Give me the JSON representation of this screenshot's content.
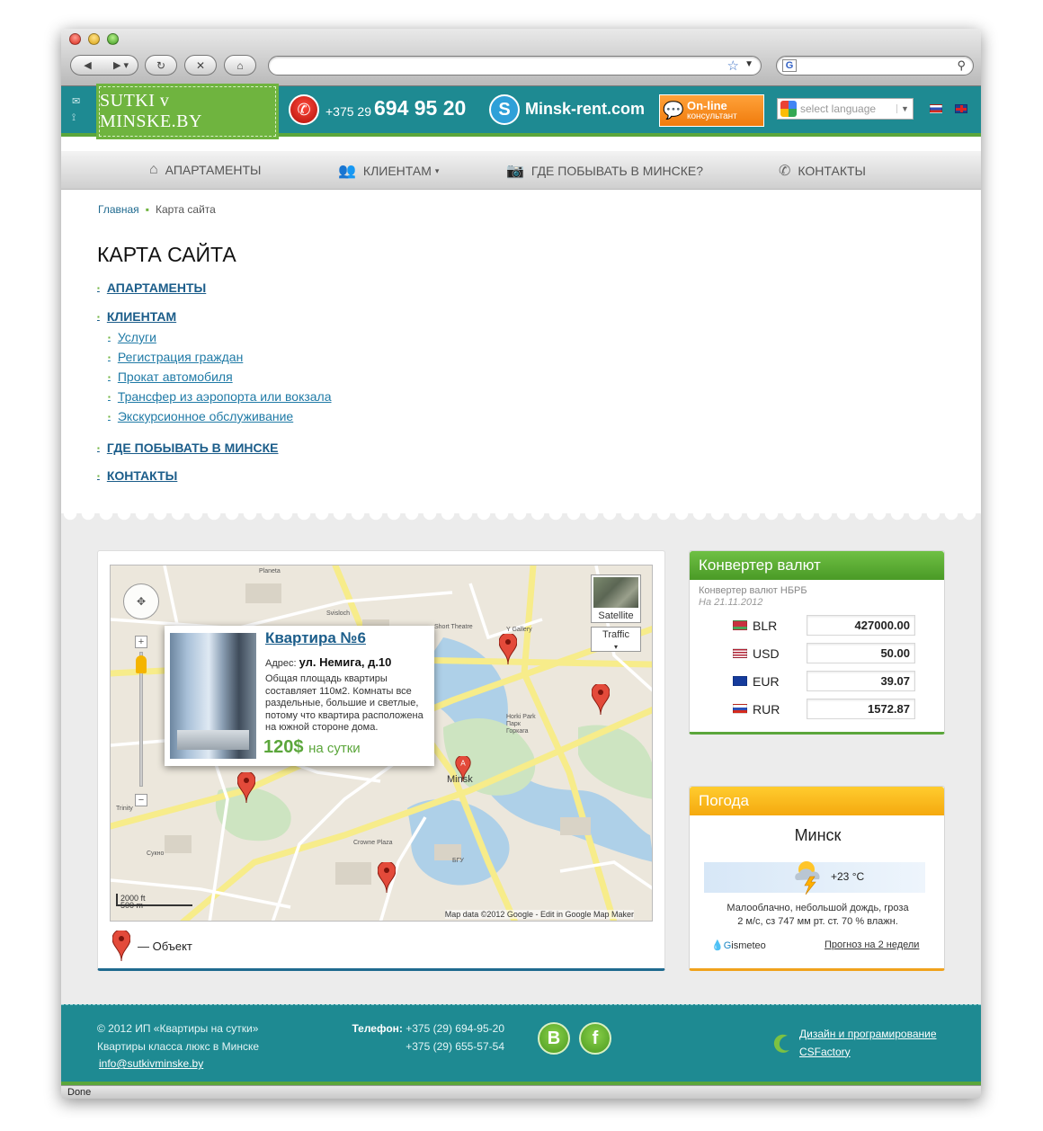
{
  "header": {
    "logo": "SUTKI v MINSKE.BY",
    "phone_code": "+375 29",
    "phone_number": "694 95 20",
    "skype_site": "Minsk-rent.com",
    "online_line1": "On-line",
    "online_line2": "консультант",
    "language_placeholder": "select language"
  },
  "nav": [
    {
      "label": "АПАРТАМЕНТЫ",
      "icon": "home-icon"
    },
    {
      "label": "КЛИЕНТАМ",
      "icon": "users-icon"
    },
    {
      "label": "ГДЕ ПОБЫВАТЬ В МИНСКЕ?",
      "icon": "camera-icon"
    },
    {
      "label": "КОНТАКТЫ",
      "icon": "phone-icon"
    }
  ],
  "breadcrumb": {
    "home": "Главная",
    "current": "Карта сайта"
  },
  "page_title": "КАРТА САЙТА",
  "sitemap": {
    "apartments": "АПАРТАМЕНТЫ",
    "clients": "КЛИЕНТАМ",
    "clients_sub": [
      "Услуги",
      "Регистрация граждан",
      "Прокат автомобиля",
      "Трансфер из аэропорта или вокзала",
      "Экскурсионное обслуживание"
    ],
    "places": "ГДЕ ПОБЫВАТЬ В МИНСКЕ",
    "contacts": "КОНТАКТЫ"
  },
  "map": {
    "satellite": "Satellite",
    "traffic": "Traffic",
    "city_label": "Minsk",
    "scale_top": "2000 ft",
    "scale_bottom": "500 m",
    "attribution": "Map data ©2012 Google - Edit in Google Map Maker",
    "info": {
      "title": "Квартира №6",
      "address_label": "Адрес:",
      "address": "ул. Немига, д.10",
      "description": "Общая площадь квартиры составляет 110м2. Комнаты все раздельные, большие и светлые, потому что квартира расположена на южной стороне дома.",
      "price": "120$",
      "price_unit": "на сутки"
    },
    "legend": "— Объект"
  },
  "converter": {
    "title": "Конвертер валют",
    "source": "Конвертер валют НБРБ",
    "date": "На 21.11.2012",
    "rates": [
      {
        "code": "BLR",
        "value": "427000.00"
      },
      {
        "code": "USD",
        "value": "50.00"
      },
      {
        "code": "EUR",
        "value": "39.07"
      },
      {
        "code": "RUR",
        "value": "1572.87"
      }
    ]
  },
  "weather": {
    "title": "Погода",
    "city": "Минск",
    "temp": "+23 °C",
    "desc_line1": "Малооблачно, небольшой дождь, гроза",
    "desc_line2": "2 м/с, сз   747 мм рт. ст.   70 % влажн.",
    "provider_prefix": "G",
    "provider": "ismeteo",
    "forecast_link": "Прогноз на 2 недели"
  },
  "footer": {
    "copy1": "© 2012 ИП «Квартиры на сутки»",
    "copy2": "Квартиры класса люкс в Минске",
    "email": "info@sutkivminske.by",
    "tel_label": "Телефон:",
    "tel1": "+375 (29) 694-95-20",
    "tel2": "+375 (29) 655-57-54",
    "design1": "Дизайн и програмирование",
    "design2": "CSFactory"
  },
  "status": "Done"
}
